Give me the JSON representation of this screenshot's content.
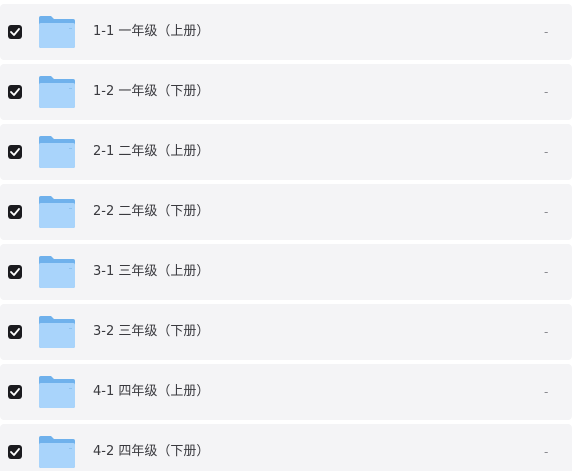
{
  "list": {
    "items": [
      {
        "name": "1-1 一年级（上册）",
        "meta": "-",
        "checked": true,
        "icon": "folder-icon"
      },
      {
        "name": "1-2 一年级（下册）",
        "meta": "-",
        "checked": true,
        "icon": "folder-icon"
      },
      {
        "name": "2-1 二年级（上册）",
        "meta": "-",
        "checked": true,
        "icon": "folder-icon"
      },
      {
        "name": "2-2 二年级（下册）",
        "meta": "-",
        "checked": true,
        "icon": "folder-icon"
      },
      {
        "name": "3-1 三年级（上册）",
        "meta": "-",
        "checked": true,
        "icon": "folder-icon"
      },
      {
        "name": "3-2 三年级（下册）",
        "meta": "-",
        "checked": true,
        "icon": "folder-icon"
      },
      {
        "name": "4-1 四年级（上册）",
        "meta": "-",
        "checked": true,
        "icon": "folder-icon"
      },
      {
        "name": "4-2 四年级（下册）",
        "meta": "-",
        "checked": true,
        "icon": "folder-icon"
      }
    ]
  },
  "colors": {
    "row_background": "#f4f4f6",
    "checkbox": "#1b1b1f",
    "folder_back": "#6fb1ec",
    "folder_front": "#a9d4fb"
  }
}
